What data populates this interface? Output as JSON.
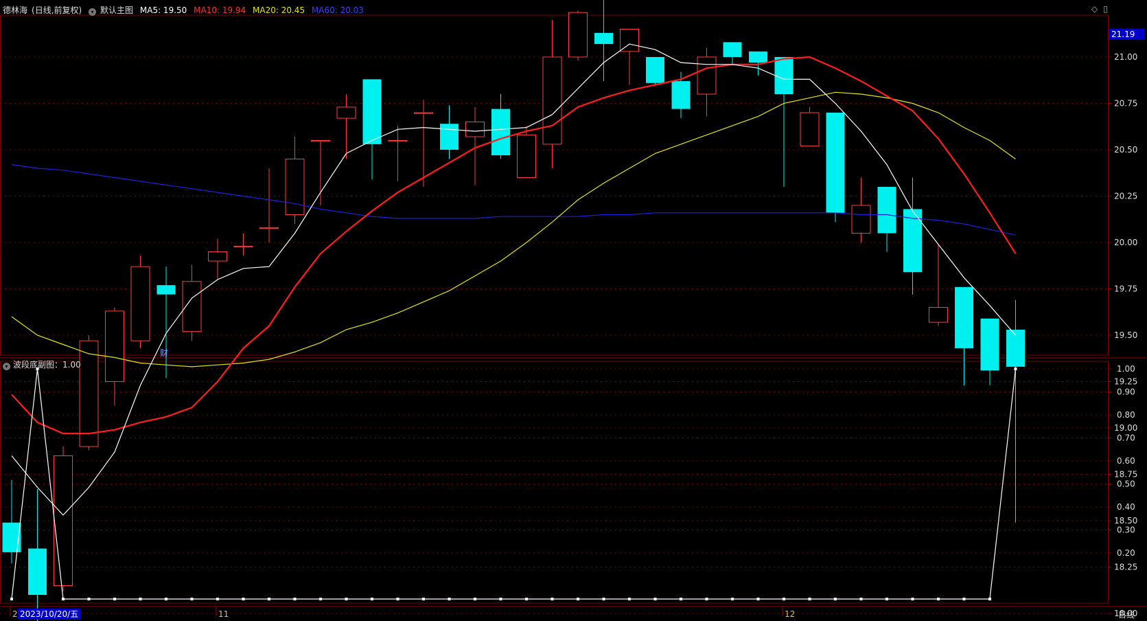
{
  "header": {
    "stock_name": "德林海",
    "mode": "(日线,前复权)",
    "indicator_name": "默认主图",
    "ma5_label": "MA5: 19.50",
    "ma10_label": "MA10: 19.94",
    "ma20_label": "MA20: 20.45",
    "ma60_label": "MA60: 20.03"
  },
  "sub_header": {
    "title": "波段底副图：1.00"
  },
  "current_price_tag": "21.19",
  "cursor_date": "2023/10/20/五",
  "period_tab": "日线",
  "finance_marker": "财",
  "x_labels": [
    "20",
    "11",
    "12"
  ],
  "colors": {
    "up": "#ff3b3b",
    "down": "#00f0f0",
    "ma5": "#ffffff",
    "ma10": "#ff1e1e",
    "ma20": "#e6e600",
    "ma60": "#1e1ee6",
    "grid": "#7a0000",
    "sub_line": "#ffffff"
  },
  "chart_data": [
    {
      "type": "candlestick",
      "y_axis_ticks": [
        "21.00",
        "20.75",
        "20.50",
        "20.25",
        "20.00",
        "19.75",
        "19.50",
        "19.25",
        "19.00",
        "18.75",
        "18.50",
        "18.25",
        "18.00"
      ],
      "annotations": {
        "high": "21.41",
        "low": "17.93"
      },
      "candles": [
        {
          "o": 18.49,
          "h": 18.72,
          "l": 18.27,
          "c": 18.33
        },
        {
          "o": 18.35,
          "h": 18.67,
          "l": 17.93,
          "c": 18.1
        },
        {
          "o": 18.15,
          "h": 18.9,
          "l": 18.12,
          "c": 18.85
        },
        {
          "o": 18.9,
          "h": 19.5,
          "l": 18.88,
          "c": 19.47
        },
        {
          "o": 19.25,
          "h": 19.65,
          "l": 19.12,
          "c": 19.63
        },
        {
          "o": 19.47,
          "h": 19.93,
          "l": 19.43,
          "c": 19.87
        },
        {
          "o": 19.77,
          "h": 19.87,
          "l": 19.27,
          "c": 19.72
        },
        {
          "o": 19.52,
          "h": 19.88,
          "l": 19.47,
          "c": 19.79
        },
        {
          "o": 19.9,
          "h": 20.02,
          "l": 19.8,
          "c": 19.95
        },
        {
          "o": 19.98,
          "h": 20.05,
          "l": 19.93,
          "c": 19.98
        },
        {
          "o": 20.08,
          "h": 20.4,
          "l": 20.0,
          "c": 20.08
        },
        {
          "o": 20.15,
          "h": 20.57,
          "l": 20.1,
          "c": 20.45
        },
        {
          "o": 20.55,
          "h": 20.55,
          "l": 20.2,
          "c": 20.55
        },
        {
          "o": 20.67,
          "h": 20.8,
          "l": 20.45,
          "c": 20.73
        },
        {
          "o": 20.88,
          "h": 20.88,
          "l": 20.34,
          "c": 20.53
        },
        {
          "o": 20.55,
          "h": 20.63,
          "l": 20.33,
          "c": 20.55
        },
        {
          "o": 20.7,
          "h": 20.77,
          "l": 20.3,
          "c": 20.7
        },
        {
          "o": 20.64,
          "h": 20.74,
          "l": 20.45,
          "c": 20.5
        },
        {
          "o": 20.57,
          "h": 20.73,
          "l": 20.31,
          "c": 20.65
        },
        {
          "o": 20.72,
          "h": 20.8,
          "l": 20.45,
          "c": 20.47
        },
        {
          "o": 20.35,
          "h": 20.63,
          "l": 20.35,
          "c": 20.58
        },
        {
          "o": 20.53,
          "h": 21.2,
          "l": 20.4,
          "c": 21.0
        },
        {
          "o": 21.0,
          "h": 21.25,
          "l": 20.98,
          "c": 21.24
        },
        {
          "o": 21.13,
          "h": 21.41,
          "l": 20.87,
          "c": 21.07
        },
        {
          "o": 21.03,
          "h": 21.15,
          "l": 20.85,
          "c": 21.15
        },
        {
          "o": 21.0,
          "h": 21.0,
          "l": 20.85,
          "c": 20.86
        },
        {
          "o": 20.87,
          "h": 20.92,
          "l": 20.67,
          "c": 20.72
        },
        {
          "o": 20.8,
          "h": 21.05,
          "l": 20.68,
          "c": 21.0
        },
        {
          "o": 21.08,
          "h": 21.08,
          "l": 20.96,
          "c": 21.0
        },
        {
          "o": 21.03,
          "h": 21.03,
          "l": 20.9,
          "c": 20.97
        },
        {
          "o": 21.0,
          "h": 21.0,
          "l": 20.3,
          "c": 20.8
        },
        {
          "o": 20.52,
          "h": 20.73,
          "l": 20.52,
          "c": 20.7
        },
        {
          "o": 20.7,
          "h": 20.7,
          "l": 20.11,
          "c": 20.16
        },
        {
          "o": 20.05,
          "h": 20.35,
          "l": 20.0,
          "c": 20.2
        },
        {
          "o": 20.3,
          "h": 20.3,
          "l": 19.95,
          "c": 20.05
        },
        {
          "o": 20.18,
          "h": 20.35,
          "l": 19.72,
          "c": 19.84
        },
        {
          "o": 19.57,
          "h": 19.99,
          "l": 19.55,
          "c": 19.65
        },
        {
          "o": 19.76,
          "h": 19.76,
          "l": 19.23,
          "c": 19.43
        },
        {
          "o": 19.59,
          "h": 19.59,
          "l": 19.23,
          "c": 19.31
        },
        {
          "o": 19.53,
          "h": 19.69,
          "l": 18.49,
          "c": 19.33
        }
      ],
      "ma5": [
        18.85,
        18.68,
        18.53,
        18.68,
        18.87,
        19.23,
        19.51,
        19.7,
        19.8,
        19.86,
        19.87,
        20.05,
        20.27,
        20.48,
        20.55,
        20.61,
        20.62,
        20.61,
        20.6,
        20.61,
        20.62,
        20.69,
        20.83,
        20.97,
        21.07,
        21.04,
        20.97,
        20.96,
        20.96,
        20.94,
        20.88,
        20.88,
        20.75,
        20.6,
        20.42,
        20.17,
        19.99,
        19.81,
        19.66,
        19.5
      ],
      "ma10": [
        19.18,
        19.03,
        18.97,
        18.97,
        18.99,
        19.03,
        19.06,
        19.11,
        19.25,
        19.43,
        19.55,
        19.76,
        19.94,
        20.06,
        20.17,
        20.27,
        20.35,
        20.43,
        20.51,
        20.56,
        20.6,
        20.63,
        20.73,
        20.78,
        20.82,
        20.85,
        20.88,
        20.94,
        20.96,
        20.96,
        20.99,
        21.0,
        20.94,
        20.87,
        20.79,
        20.71,
        20.56,
        20.37,
        20.16,
        19.94
      ],
      "ma20": [
        19.6,
        19.5,
        19.45,
        19.4,
        19.38,
        19.35,
        19.34,
        19.33,
        19.34,
        19.35,
        19.37,
        19.41,
        19.46,
        19.53,
        19.57,
        19.62,
        19.68,
        19.74,
        19.82,
        19.9,
        20.0,
        20.11,
        20.23,
        20.32,
        20.4,
        20.48,
        20.53,
        20.58,
        20.63,
        20.68,
        20.75,
        20.78,
        20.81,
        20.8,
        20.78,
        20.75,
        20.7,
        20.62,
        20.55,
        20.45
      ],
      "ma60": [
        20.42,
        20.4,
        20.39,
        20.37,
        20.35,
        20.33,
        20.31,
        20.29,
        20.27,
        20.25,
        20.23,
        20.21,
        20.18,
        20.16,
        20.14,
        20.13,
        20.13,
        20.13,
        20.13,
        20.14,
        20.14,
        20.14,
        20.14,
        20.15,
        20.15,
        20.16,
        20.16,
        20.16,
        20.16,
        20.16,
        20.16,
        20.16,
        20.16,
        20.15,
        20.15,
        20.13,
        20.12,
        20.1,
        20.07,
        20.04
      ]
    },
    {
      "type": "line",
      "title": "波段底副图",
      "y_axis_ticks": [
        "1.00",
        "0.90",
        "0.80",
        "0.70",
        "0.60",
        "0.50",
        "0.40",
        "0.30",
        "0.20"
      ],
      "values": [
        0,
        1,
        0,
        0,
        0,
        0,
        0,
        0,
        0,
        0,
        0,
        0,
        0,
        0,
        0,
        0,
        0,
        0,
        0,
        0,
        0,
        0,
        0,
        0,
        0,
        0,
        0,
        0,
        0,
        0,
        0,
        0,
        0,
        0,
        0,
        0,
        0,
        0,
        0,
        1
      ]
    }
  ]
}
